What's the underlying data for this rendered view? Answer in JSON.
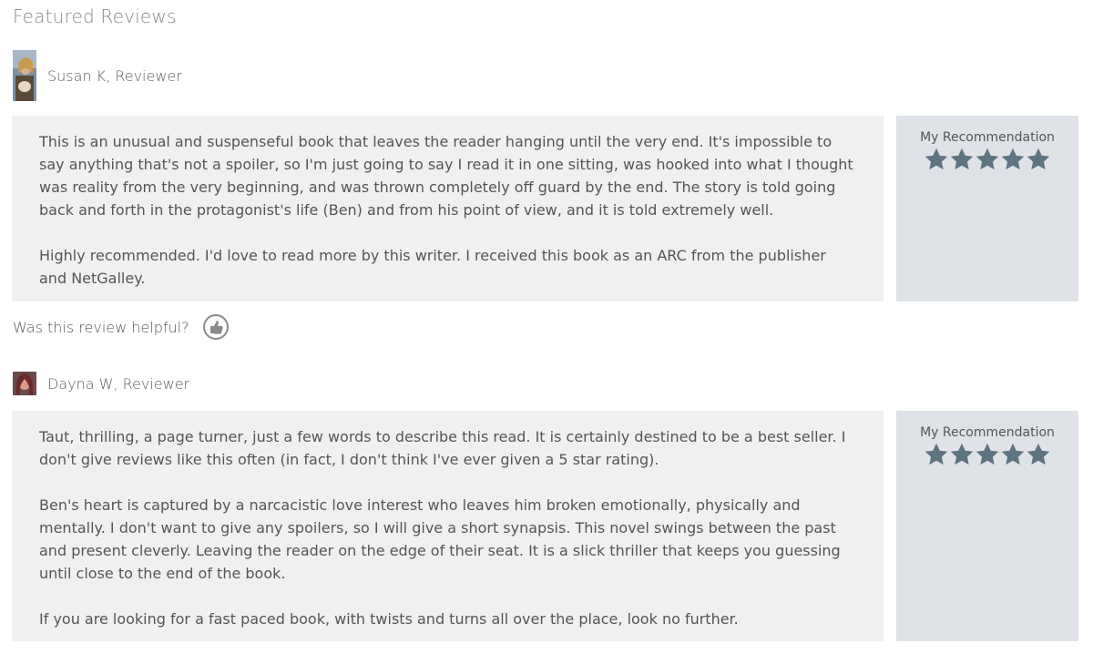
{
  "section_title": "Featured Reviews",
  "reviews": [
    {
      "reviewer": "Susan K, Reviewer",
      "paragraphs": [
        "This is an unusual and suspenseful book that leaves the reader hanging until the very end. It's impossible to say anything that's not a spoiler, so I'm just going to say I read it in one sitting, was hooked into what I thought was reality from the very beginning, and was thrown completely off guard by the end. The story is told going back and forth in the protagonist's life (Ben) and from his point of view, and it is told extremely well.",
        "Highly recommended. I'd love to read more by this writer. I received this book as an ARC from the publisher and NetGalley."
      ],
      "recommendation_label": "My Recommendation",
      "rating": 5
    },
    {
      "reviewer": "Dayna W, Reviewer",
      "paragraphs": [
        "Taut, thrilling, a page turner, just a few words to describe this read.  It is certainly destined to be a best seller.  I don't give reviews like this often (in fact, I don't think I've ever given a 5 star rating).",
        "Ben's heart is captured by a narcacistic love interest who leaves him broken emotionally, physically and mentally.  I don't want to give any spoilers, so I will give a short synapsis. This novel swings between the past and present cleverly.  Leaving the reader on the edge of their seat.  It is a slick thriller that keeps you guessing until close to the end of the book.",
        "If you are looking for a fast paced book, with twists and turns all over the place, look no further."
      ],
      "recommendation_label": "My Recommendation",
      "rating": 5
    }
  ],
  "helpful_prompt": "Was this review helpful?",
  "icons": {
    "star": "star-icon",
    "thumb": "thumbs-up-icon"
  },
  "colors": {
    "review_bg": "#f0f0f0",
    "recommendation_bg": "#dfe3e8",
    "star_fill": "#5f7481"
  }
}
